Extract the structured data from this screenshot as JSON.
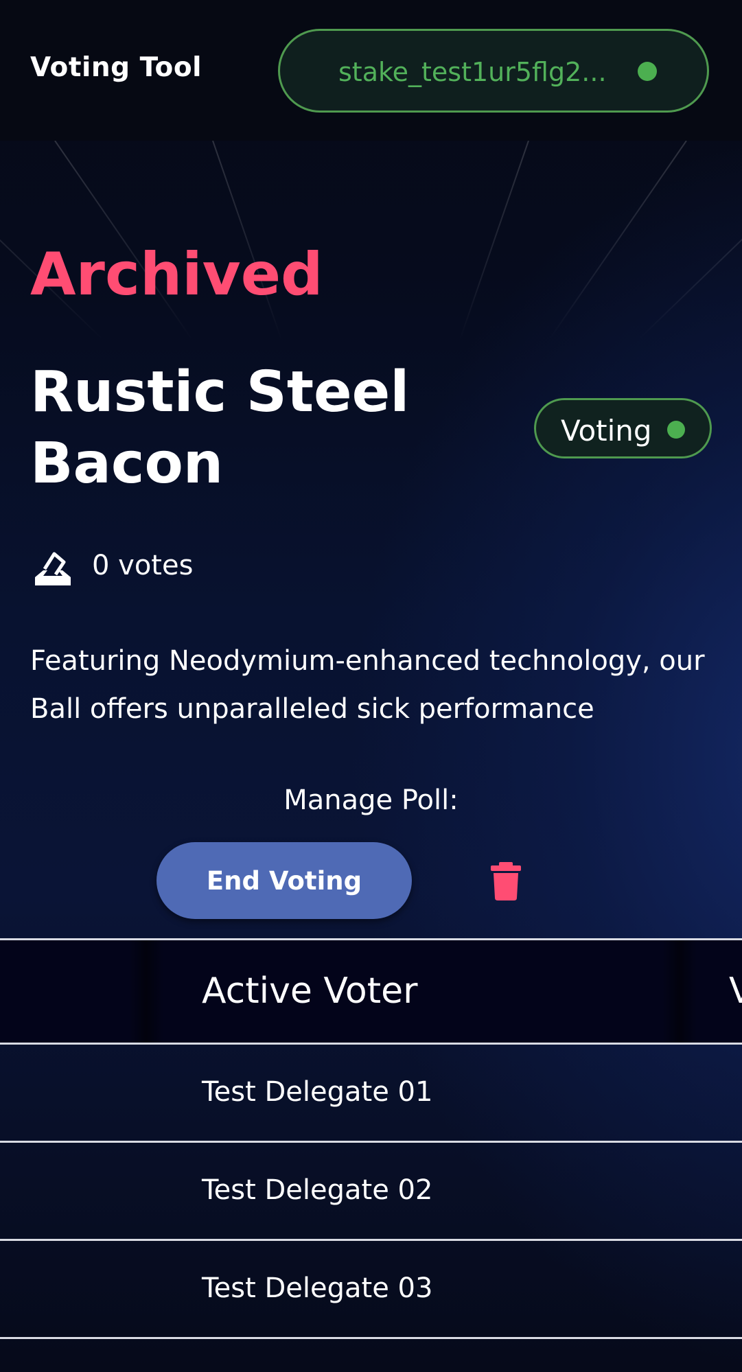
{
  "header": {
    "app_title": "Voting Tool",
    "wallet_address": "stake_test1ur5flg2...",
    "wallet_status_color": "#4caf50"
  },
  "poll": {
    "archived_label": "Archived",
    "title": "Rustic Steel Bacon",
    "status_label": "Voting",
    "votes_text": "0 votes",
    "description": "Featuring Neodymium-enhanced technology, our Ball offers unparalleled sick performance"
  },
  "manage": {
    "label": "Manage Poll:",
    "end_voting_label": "End Voting",
    "delete_icon": "trash-icon"
  },
  "table": {
    "headers": [
      "Active Voter",
      "V"
    ],
    "rows": [
      "Test Delegate 01",
      "Test Delegate 02",
      "Test Delegate 03"
    ]
  },
  "colors": {
    "accent_pink": "#ff4d73",
    "accent_green": "#4caf50",
    "button_blue": "#4f6ab5"
  }
}
